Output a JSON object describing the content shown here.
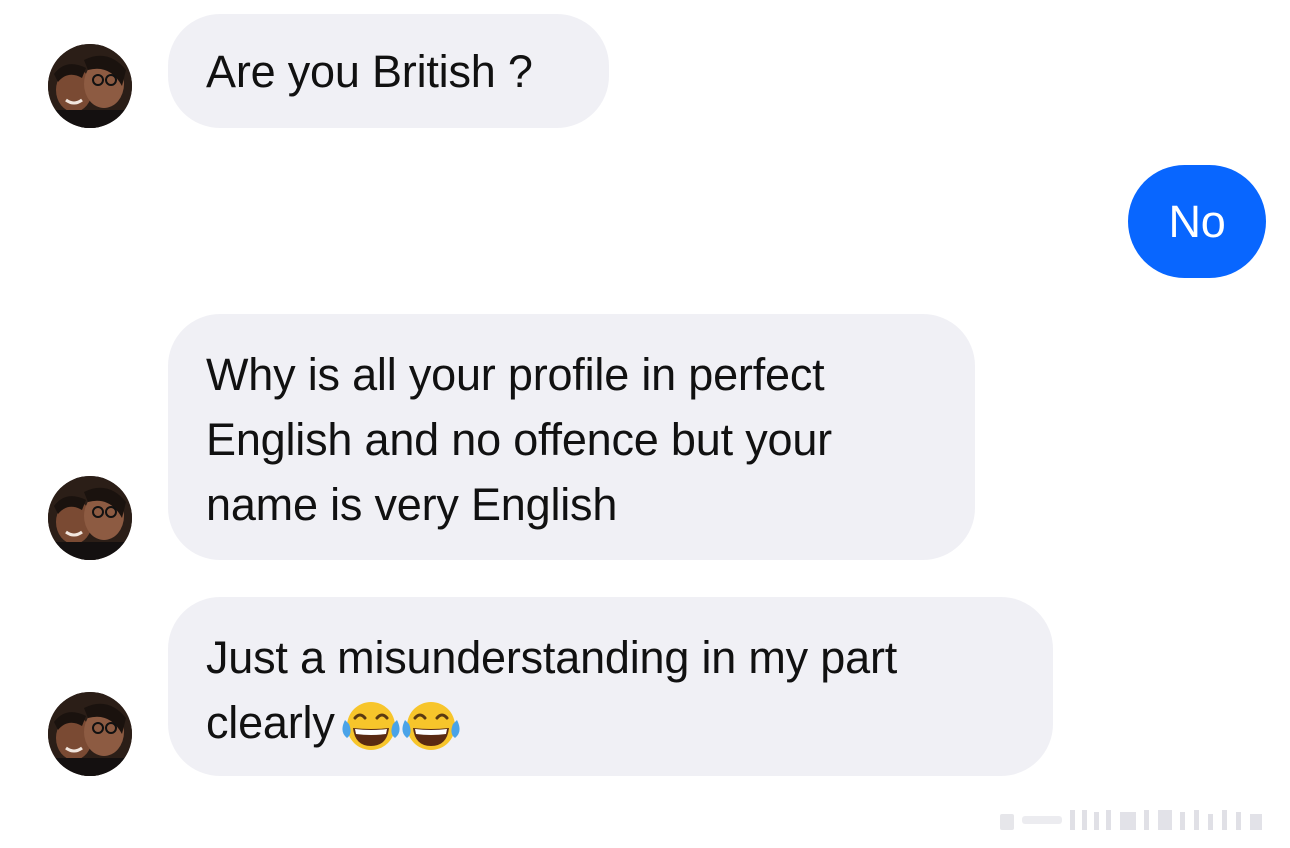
{
  "conversation": {
    "messages": [
      {
        "sender": "other",
        "text": "Are you British ?",
        "show_avatar": true
      },
      {
        "sender": "me",
        "text": "No"
      },
      {
        "sender": "other",
        "text": "Why is all your profile in perfect English and no offence but your name is very English",
        "show_avatar": true
      },
      {
        "sender": "other",
        "text": "Just a misunderstanding in my part clearly",
        "emoji": [
          "face-with-tears-of-joy",
          "face-with-tears-of-joy"
        ],
        "show_avatar": true
      }
    ]
  },
  "colors": {
    "incoming_bubble": "#f0f0f5",
    "outgoing_bubble": "#0866ff",
    "outgoing_text": "#ffffff",
    "incoming_text": "#111111"
  },
  "icons": {
    "avatar": "profile-photo-icon",
    "emoji": "face-with-tears-of-joy-icon"
  }
}
